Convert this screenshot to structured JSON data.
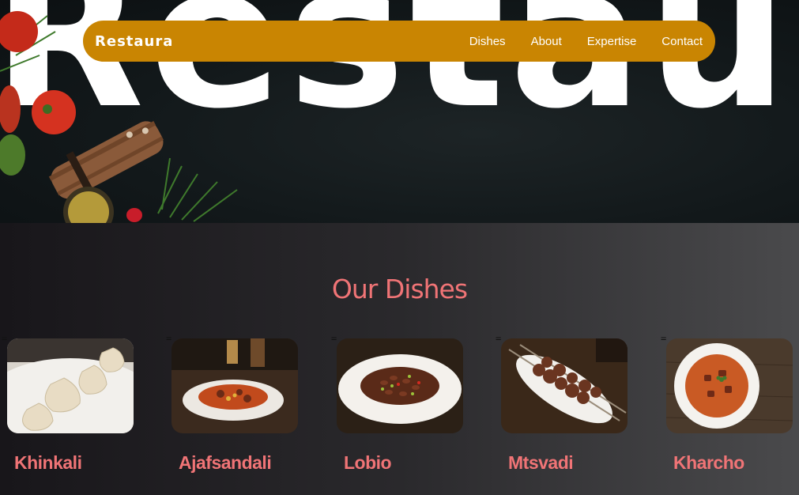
{
  "hero": {
    "background_word": "Restaura"
  },
  "navbar": {
    "brand": "Restaura",
    "links": [
      "Dishes",
      "About",
      "Expertise",
      "Contact"
    ],
    "bg_color": "#c98502"
  },
  "dishes_section": {
    "title": "Our Dishes",
    "title_color": "#f07476",
    "cards": [
      {
        "marker": "=",
        "name": "Khinkali",
        "image": "dumplings-on-plate"
      },
      {
        "marker": "=",
        "name": "Ajafsandali",
        "image": "vegetable-stew-bowl"
      },
      {
        "marker": "=",
        "name": "Lobio",
        "image": "bean-dish-plate"
      },
      {
        "marker": "=",
        "name": "Mtsvadi",
        "image": "skewers-on-plate"
      },
      {
        "marker": "=",
        "name": "Kharcho",
        "image": "soup-bowl"
      }
    ]
  }
}
